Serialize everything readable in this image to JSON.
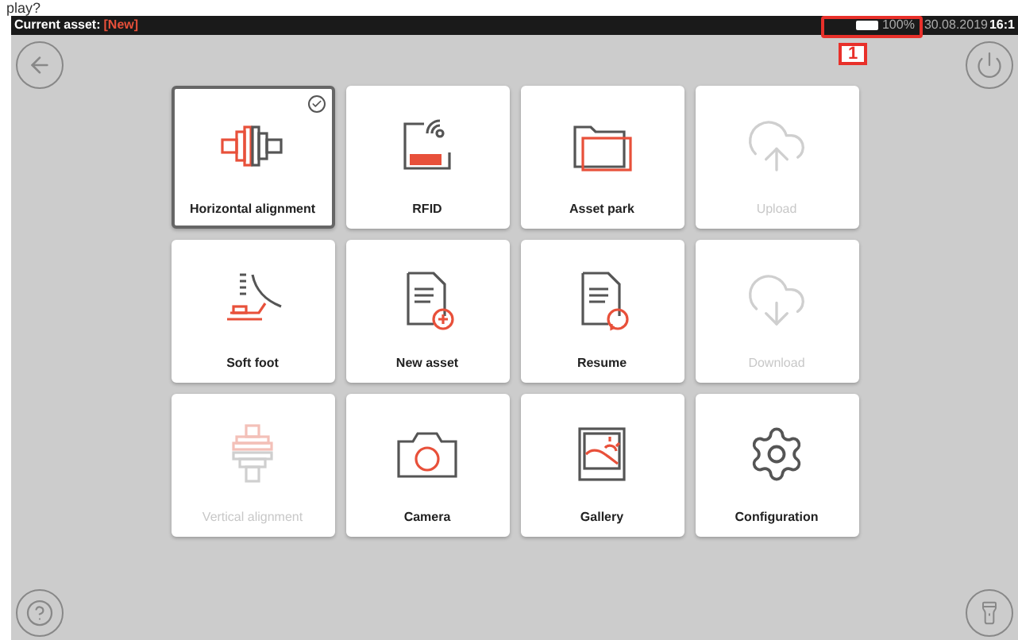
{
  "caption": "play?",
  "status_bar": {
    "label": "Current asset:",
    "asset": "[New]",
    "battery": "100%",
    "date": "30.08.2019",
    "time": "16:1"
  },
  "annotation": {
    "number": "1"
  },
  "tiles": [
    {
      "kind": "horizontal",
      "label": "Horizontal alignment",
      "selected": true,
      "disabled": false
    },
    {
      "kind": "rfid",
      "label": "RFID",
      "selected": false,
      "disabled": false
    },
    {
      "kind": "folder",
      "label": "Asset park",
      "selected": false,
      "disabled": false
    },
    {
      "kind": "upload",
      "label": "Upload",
      "selected": false,
      "disabled": true
    },
    {
      "kind": "softfoot",
      "label": "Soft foot",
      "selected": false,
      "disabled": false
    },
    {
      "kind": "newasset",
      "label": "New asset",
      "selected": false,
      "disabled": false
    },
    {
      "kind": "resume",
      "label": "Resume",
      "selected": false,
      "disabled": false
    },
    {
      "kind": "download",
      "label": "Download",
      "selected": false,
      "disabled": true
    },
    {
      "kind": "vertical",
      "label": "Vertical alignment",
      "selected": false,
      "disabled": true
    },
    {
      "kind": "camera",
      "label": "Camera",
      "selected": false,
      "disabled": false
    },
    {
      "kind": "gallery",
      "label": "Gallery",
      "selected": false,
      "disabled": false
    },
    {
      "kind": "config",
      "label": "Configuration",
      "selected": false,
      "disabled": false
    }
  ]
}
